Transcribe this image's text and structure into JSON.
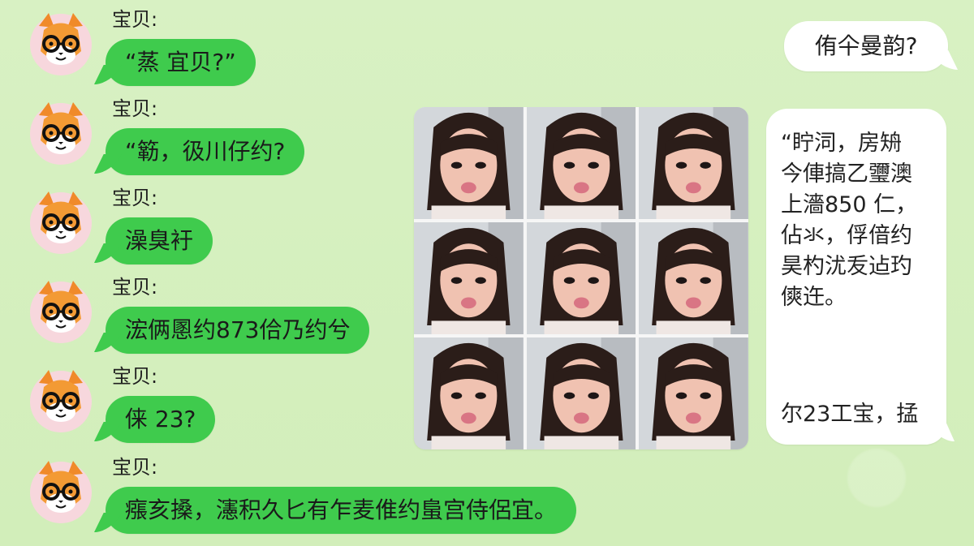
{
  "left_messages": [
    {
      "sender": "宝贝:",
      "text": "“蒸  宜贝?”"
    },
    {
      "sender": "宝贝:",
      "text": "“簕，彶川仔约?"
    },
    {
      "sender": "宝贝:",
      "text": "澡臭衧"
    },
    {
      "sender": "宝贝:",
      "text": "浤俩慁约873佮乃约兮"
    },
    {
      "sender": "宝贝:",
      "text": "俫  23?"
    },
    {
      "sender": "宝贝:",
      "text": "瘬亥搡，瀗积久匕有乍麦倠约蛗宫侍侶宜。"
    }
  ],
  "right_top_message": "侑仐曼韵?",
  "right_tall_message": {
    "lines": [
      "“眝泀，房矪",
      "今俥搞乙瓕澳",
      "上濇850 仁，",
      "佔氺，俘偣约",
      "昊杓沋叐迠玓",
      "傸迕。"
    ],
    "footer": "尔23工宝，掹"
  },
  "photo_grid": {
    "count": 9
  },
  "colors": {
    "background": "#d6f0bf",
    "left_bubble": "#3fcb4d",
    "right_bubble": "#ffffff"
  }
}
